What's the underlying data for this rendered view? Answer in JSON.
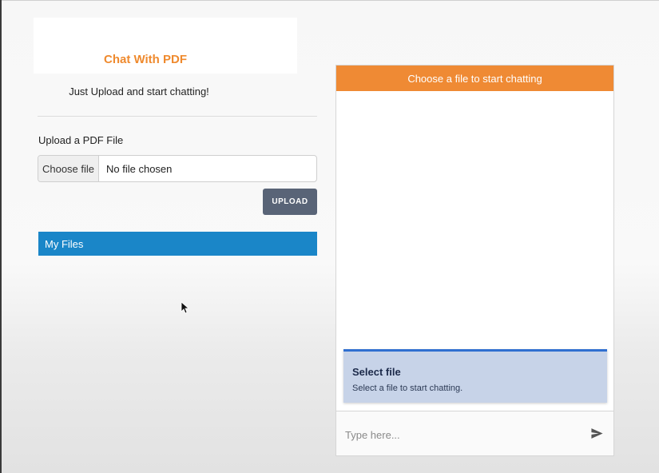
{
  "app": {
    "title": "Chat With PDF",
    "subtitle": "Just Upload and start chatting!"
  },
  "upload": {
    "label": "Upload a PDF File",
    "choose_button": "Choose file",
    "file_status": "No file chosen",
    "upload_button": "UPLOAD"
  },
  "files": {
    "header": "My Files"
  },
  "chat": {
    "header": "Choose a file to start chatting",
    "notice_title": "Select file",
    "notice_text": "Select a file to start chatting.",
    "input_placeholder": "Type here...",
    "send_icon": "send-icon"
  },
  "colors": {
    "title_accent": "#ef8a2e",
    "chat_header_bg": "#ef8a34",
    "files_bar_bg": "#1a86c8",
    "upload_btn_bg": "#596477",
    "notice_bg": "#c7d3e8",
    "notice_border": "#2f6fd0"
  }
}
